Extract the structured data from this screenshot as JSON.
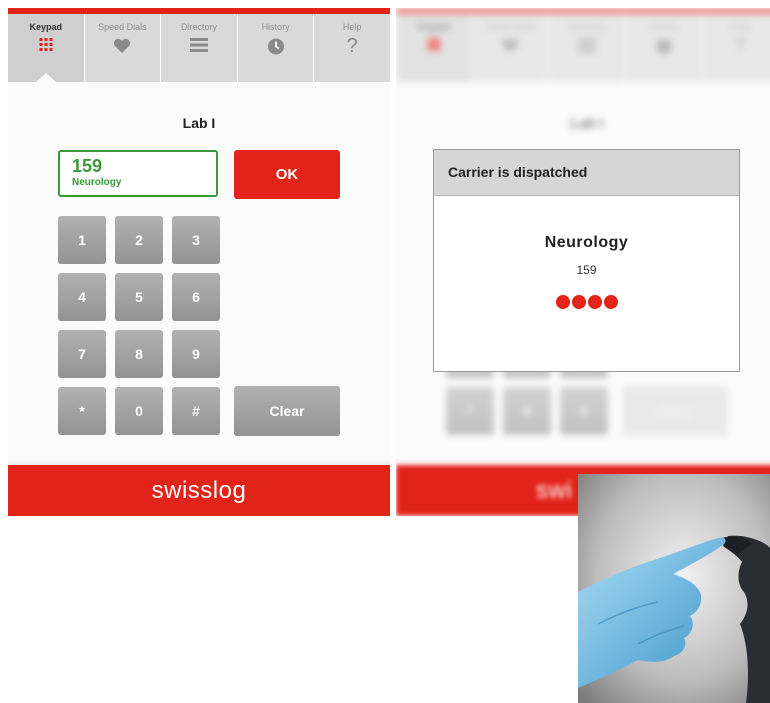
{
  "tabs": [
    {
      "label": "Keypad",
      "icon": "keypad-grid-icon",
      "active": true
    },
    {
      "label": "Speed Dials",
      "icon": "heart-icon",
      "active": false
    },
    {
      "label": "Directory",
      "icon": "list-icon",
      "active": false
    },
    {
      "label": "History",
      "icon": "clock-icon",
      "active": false
    },
    {
      "label": "Help",
      "icon": "question-mark-icon",
      "active": false
    }
  ],
  "keypad_screen": {
    "title": "Lab I",
    "number_field": {
      "value": "159",
      "department": "Neurology"
    },
    "ok_label": "OK",
    "keys": [
      "1",
      "2",
      "3",
      "4",
      "5",
      "6",
      "7",
      "8",
      "9",
      "*",
      "0",
      "#"
    ],
    "clear_label": "Clear"
  },
  "footer": {
    "logo": "swisslog",
    "logo_partial": "swi"
  },
  "dispatch_screen": {
    "title": "Lab I",
    "modal": {
      "header": "Carrier is dispatched",
      "department": "Neurology",
      "number": "159",
      "progress_dots": 4
    }
  },
  "colors": {
    "brand_red": "#e2231a",
    "green": "#3a9a3a",
    "key_gray": "#a2a2a2",
    "tab_gray": "#d9d9d9"
  }
}
